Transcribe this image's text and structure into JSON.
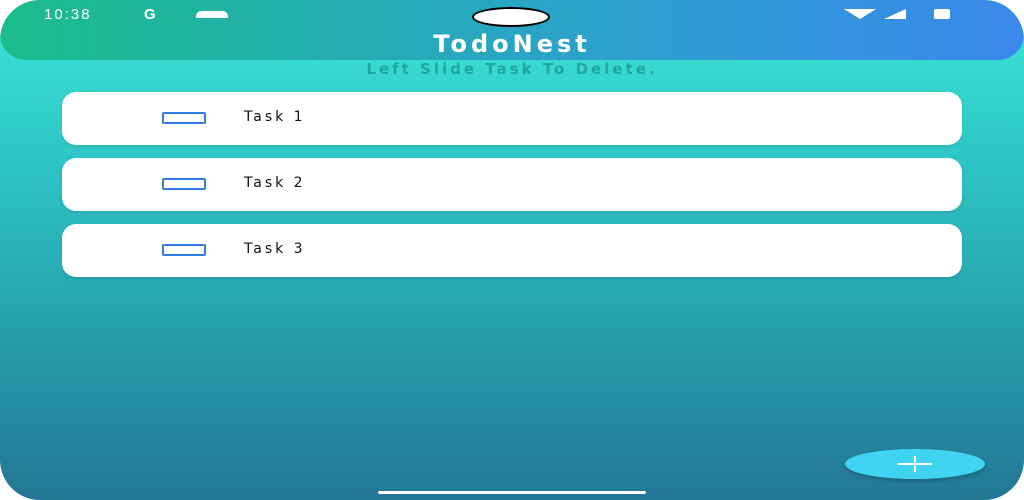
{
  "status_bar": {
    "time": "10:38",
    "notification_icon": "G",
    "icons": [
      "cloud-icon",
      "wifi-icon",
      "signal-icon",
      "battery-icon"
    ]
  },
  "app": {
    "title": "TodoNest",
    "hint": "Left Slide Task To Delete."
  },
  "tasks": [
    {
      "label": "Task 1",
      "checked": false
    },
    {
      "label": "Task 2",
      "checked": false
    },
    {
      "label": "Task 3",
      "checked": false
    }
  ],
  "fab": {
    "icon": "plus-icon"
  },
  "colors": {
    "appbar_start": "#1bbd8b",
    "appbar_end": "#3a88ec",
    "background_top": "#3de6d6",
    "background_bottom": "#237795",
    "checkbox": "#2f7de0",
    "fab": "#3fd4f2"
  }
}
